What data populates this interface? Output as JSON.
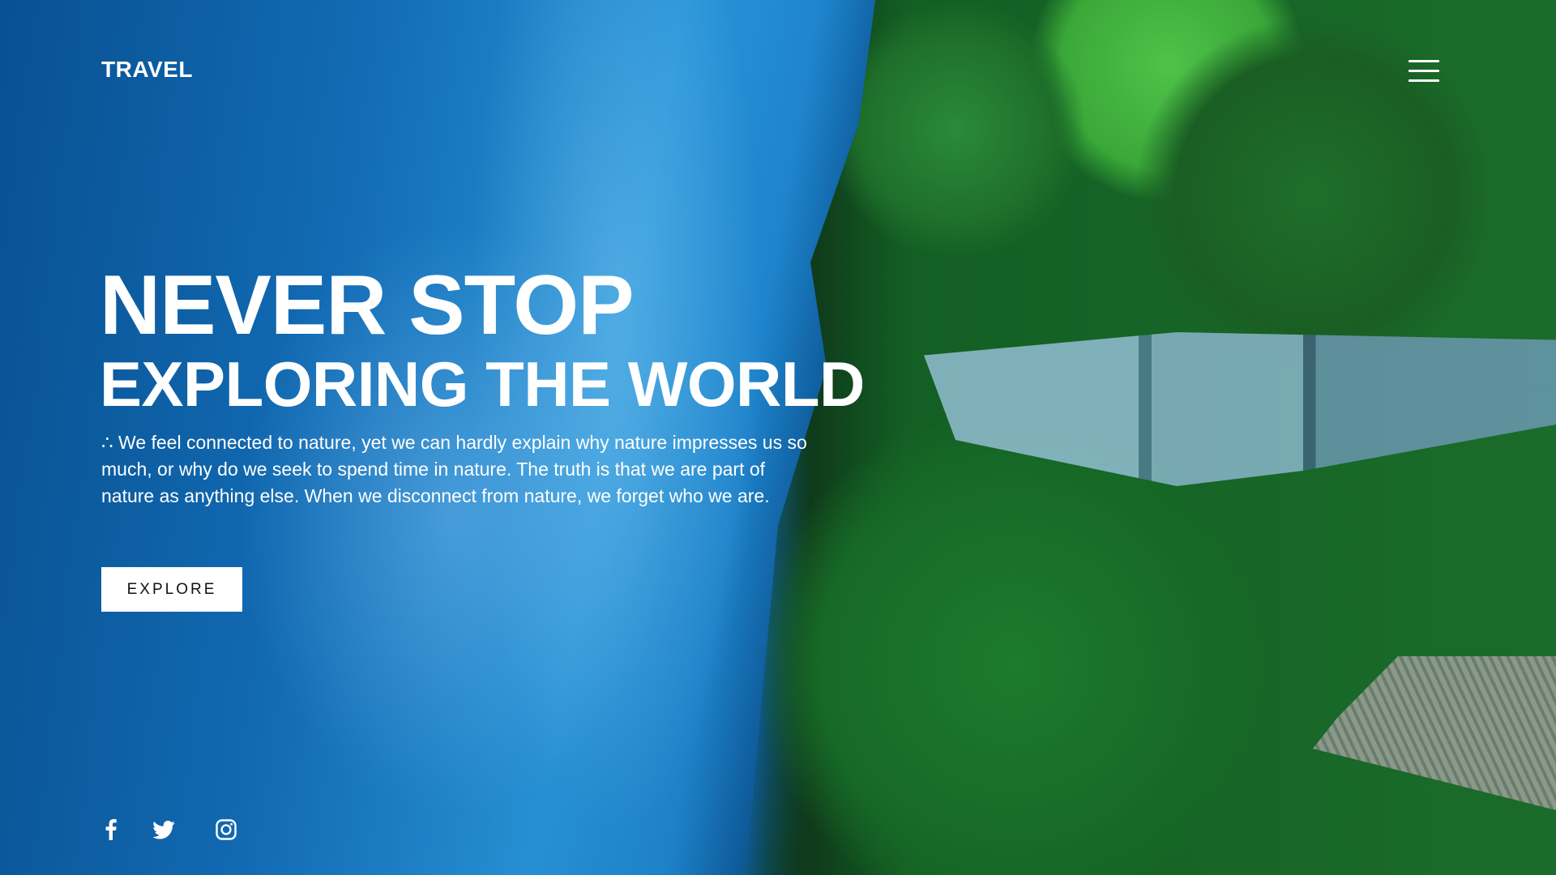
{
  "header": {
    "logo": "TRAVEL",
    "menu_icon": "hamburger-menu-icon"
  },
  "hero": {
    "headline_line1": "NEVER STOP",
    "headline_line2": "EXPLORING THE WORLD",
    "description": "∴ We feel connected to nature, yet we can hardly explain why nature impresses us so much, or why do we seek to spend time in nature. The truth is that we are part of nature as anything else. When we disconnect from nature, we forget who we are.",
    "cta_label": "EXPLORE",
    "background": "aerial view of blue sea coastline with green trees and rooftops"
  },
  "social": {
    "icons": [
      "facebook-icon",
      "twitter-icon",
      "instagram-icon"
    ]
  },
  "colors": {
    "text": "#ffffff",
    "button_bg": "#ffffff",
    "button_text": "#111111",
    "sea": "#1a7cc8",
    "foliage": "#1b6c2a"
  }
}
